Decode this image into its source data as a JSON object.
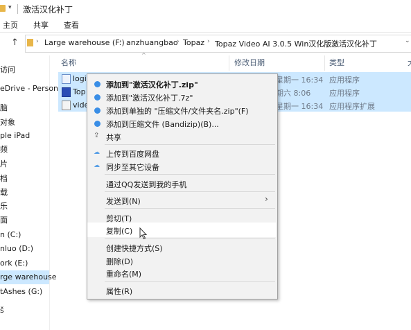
{
  "window": {
    "title": "激活汉化补丁"
  },
  "ribbon": {
    "tabs": [
      "主页",
      "共享",
      "查看"
    ]
  },
  "address": {
    "crumbs": [
      "Large warehouse (F:)",
      "anzhuangbao",
      "Topaz",
      "Topaz Video AI 3.0.5 Win汉化版",
      "激活汉化补丁"
    ]
  },
  "nav": {
    "items": [
      "访问",
      "eDrive - Person",
      "脑",
      "对象",
      "ple iPad",
      "频",
      "片",
      "档",
      "载",
      "乐",
      "面",
      "n (C:)",
      "nluo (D:)",
      "ork (E:)",
      "rge warehouse",
      "tAshes (G:)",
      "š"
    ]
  },
  "columns": {
    "name": "名称",
    "date": "修改日期",
    "type": "类型",
    "size": "大"
  },
  "files": [
    {
      "name": "logi",
      "date": "星期一 16:34",
      "type": "应用程序"
    },
    {
      "name": "Top",
      "date": "期六 8:06",
      "type": "应用程序"
    },
    {
      "name": "vide",
      "date": "星期一 16:34",
      "type": "应用程序扩展"
    }
  ],
  "context_menu": {
    "add_zip": "添加到\"激活汉化补丁.zip\"",
    "add_7z": "添加到\"激活汉化补丁.7z\"",
    "add_separate": "添加到单独的 \"压缩文件/文件夹名.zip\"(F)",
    "add_archive": "添加到压缩文件 (Bandizip)(B)...",
    "share": "共享",
    "upload_baidu": "上传到百度网盘",
    "sync_devices": "同步至其它设备",
    "send_qq": "通过QQ发送到我的手机",
    "send_to": "发送到(N)",
    "cut": "剪切(T)",
    "copy": "复制(C)",
    "create_shortcut": "创建快捷方式(S)",
    "delete": "删除(D)",
    "rename": "重命名(M)",
    "properties": "属性(R)"
  },
  "colors": {
    "selection": "#cce8ff",
    "menu_bg": "#f2f2f2",
    "folder": "#e8b64a"
  },
  "icons": {
    "bandizip": "bandizip-icon",
    "baidu": "cloud-icon",
    "share": "share-icon",
    "submenu": "chevron-right-icon"
  }
}
